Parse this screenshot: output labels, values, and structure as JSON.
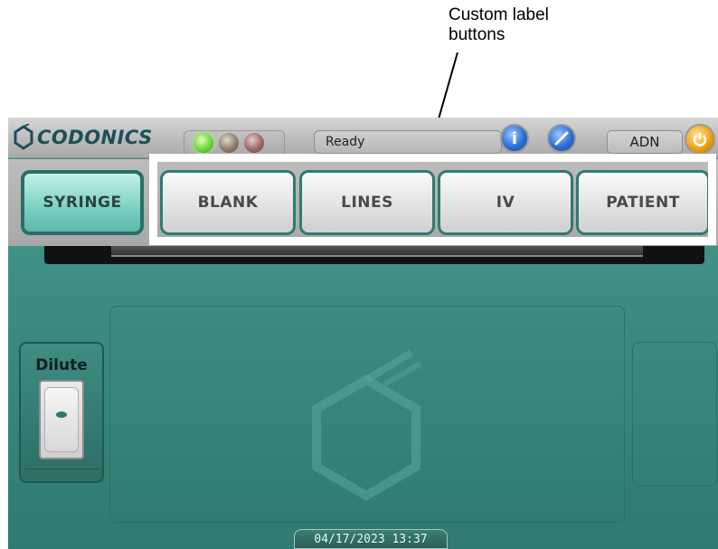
{
  "callout": {
    "line1": "Custom label",
    "line2": "buttons"
  },
  "topbar": {
    "logo_text": "CODONICS",
    "logo_icon": "codonics-hex-icon",
    "status": "Ready",
    "info_icon": "info-icon",
    "help_icon": "help-icon",
    "user": "ADN",
    "logout_icon": "power-icon"
  },
  "label_buttons": {
    "syringe": "SYRINGE",
    "blank": "BLANK",
    "lines": "LINES",
    "iv": "IV",
    "patient": "PATIENT"
  },
  "dilute": {
    "label": "Dilute"
  },
  "footer": {
    "timestamp": "04/17/2023 13:37"
  },
  "colors": {
    "teal": "#3d8d83",
    "active_button": "#7ccfc3",
    "led_green": "#7ee04d"
  }
}
